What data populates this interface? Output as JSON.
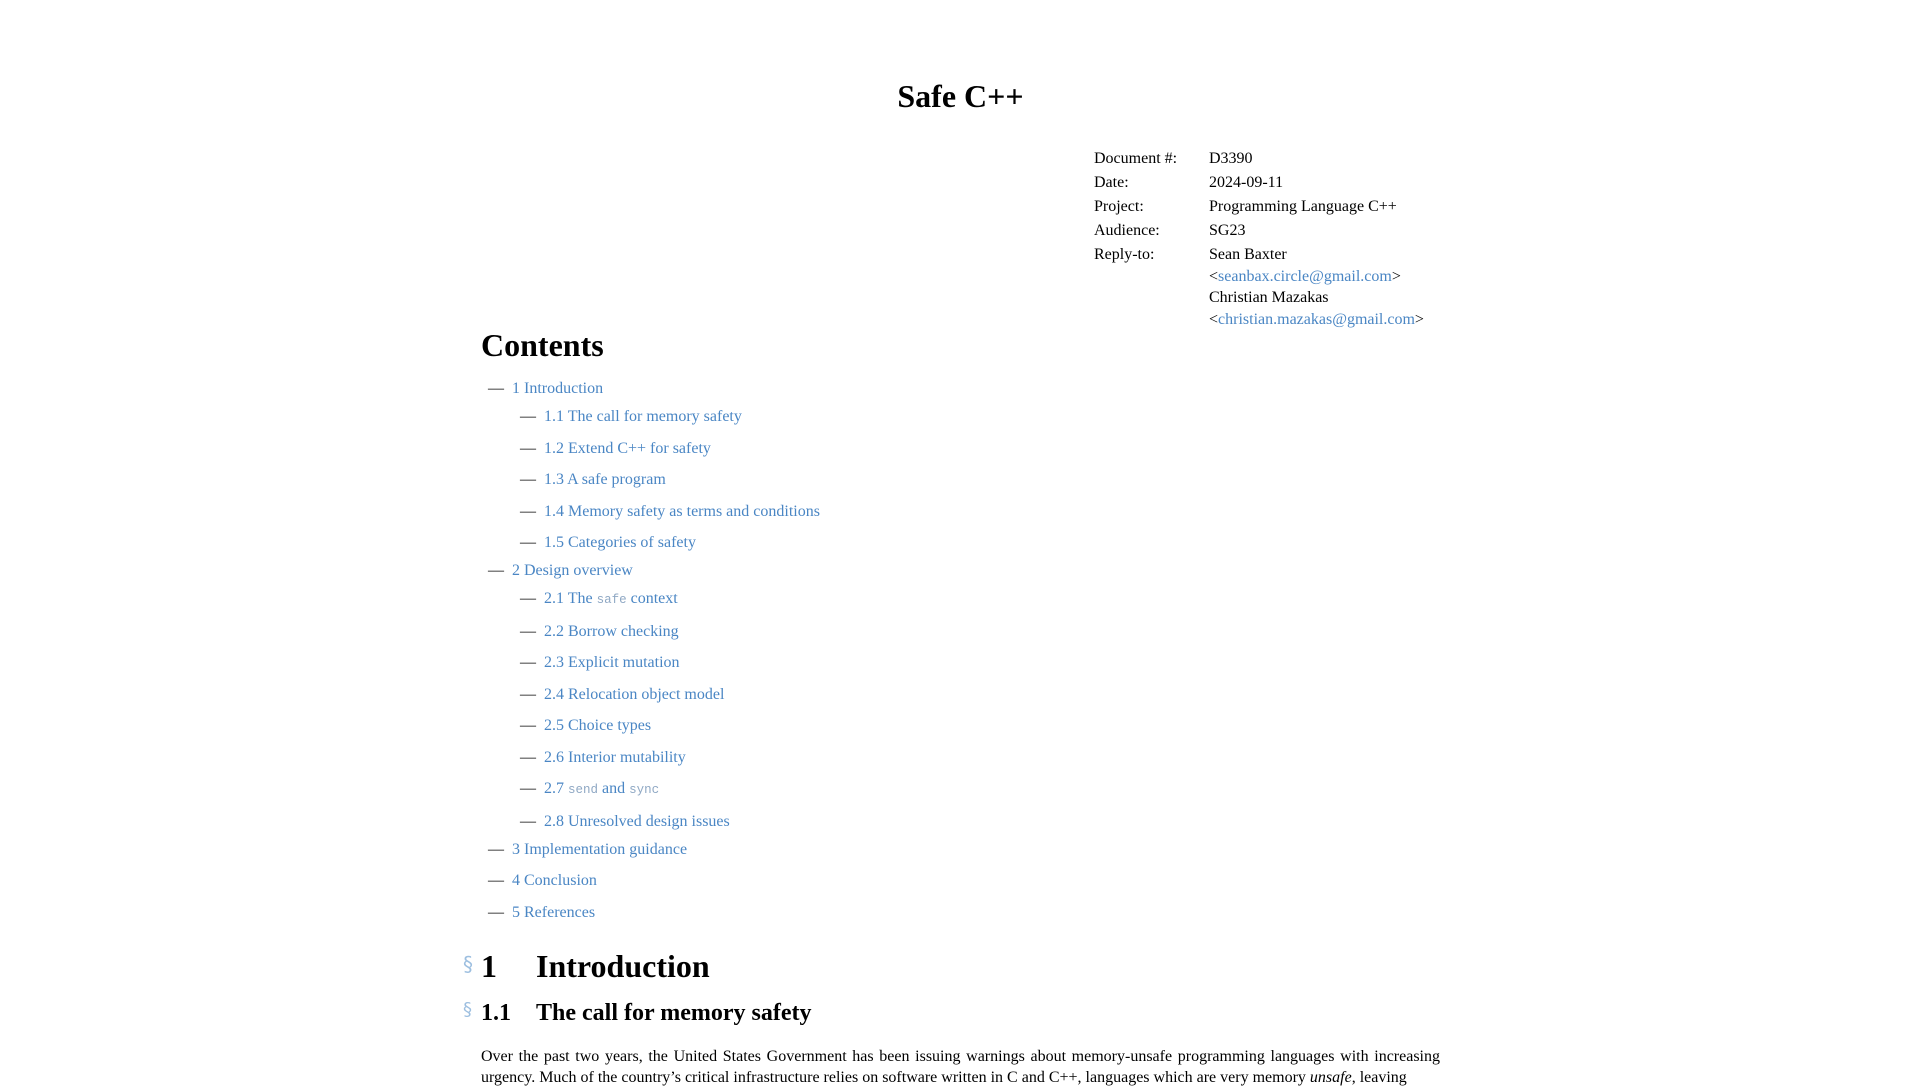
{
  "document": {
    "title": "Safe C++",
    "metadata": [
      {
        "label": "Document #:",
        "value": "D3390"
      },
      {
        "label": "Date:",
        "value": "2024-09-11"
      },
      {
        "label": "Project:",
        "value": "Programming Language C++"
      },
      {
        "label": "Audience:",
        "value": "SG23"
      }
    ],
    "reply_to": {
      "label": "Reply-to:",
      "authors": [
        {
          "name": "Sean Baxter",
          "email": "seanbax.circle@gmail.com"
        },
        {
          "name": "Christian Mazakas",
          "email": "christian.mazakas@gmail.com"
        }
      ]
    },
    "colors": {
      "link": "#4a86c4",
      "section_mark": "#9dbfe0",
      "code_in_link": "#8fa8c4"
    }
  },
  "contents": {
    "heading": "Contents",
    "dash": "—",
    "items": [
      {
        "number": "1",
        "label": "Introduction",
        "children": [
          {
            "number": "1.1",
            "label": "The call for memory safety"
          },
          {
            "number": "1.2",
            "label": "Extend C++ for safety"
          },
          {
            "number": "1.3",
            "label": "A safe program"
          },
          {
            "number": "1.4",
            "label": "Memory safety as terms and conditions"
          },
          {
            "number": "1.5",
            "label": "Categories of safety"
          }
        ]
      },
      {
        "number": "2",
        "label": "Design overview",
        "children": [
          {
            "number": "2.1",
            "label_parts": [
              "The ",
              "safe",
              " context"
            ]
          },
          {
            "number": "2.2",
            "label": "Borrow checking"
          },
          {
            "number": "2.3",
            "label": "Explicit mutation"
          },
          {
            "number": "2.4",
            "label": "Relocation object model"
          },
          {
            "number": "2.5",
            "label": "Choice types"
          },
          {
            "number": "2.6",
            "label": "Interior mutability"
          },
          {
            "number": "2.7",
            "label_parts": [
              "send",
              " and ",
              "sync"
            ]
          },
          {
            "number": "2.8",
            "label": "Unresolved design issues"
          }
        ]
      },
      {
        "number": "3",
        "label": "Implementation guidance"
      },
      {
        "number": "4",
        "label": "Conclusion"
      },
      {
        "number": "5",
        "label": "References"
      }
    ]
  },
  "sections": {
    "section_mark": "§",
    "h1": {
      "number": "1",
      "title": "Introduction"
    },
    "h2": {
      "number": "1.1",
      "title": "The call for memory safety"
    },
    "paragraph": {
      "before_em": "Over the past two years, the United States Government has been issuing warnings about memory-unsafe programming languages with increasing urgency. Much of the country’s critical infrastructure relies on software written in C and C++, languages which are very memory ",
      "em": "unsafe",
      "after_em": ", leaving"
    }
  }
}
